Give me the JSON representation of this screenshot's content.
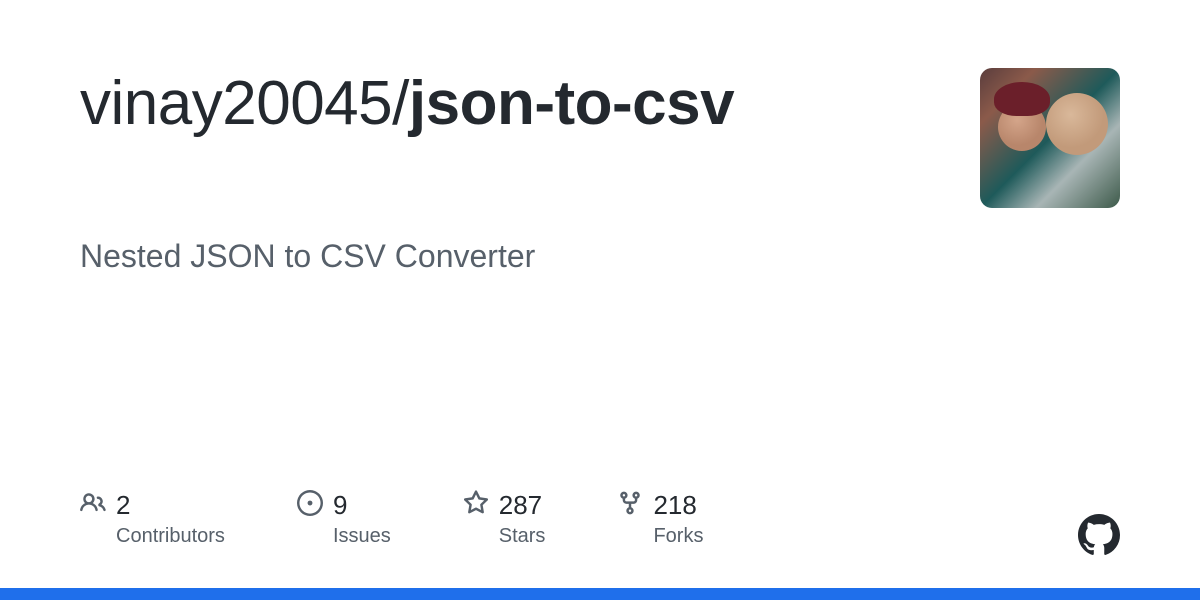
{
  "repo": {
    "owner": "vinay20045",
    "name": "json-to-csv",
    "description": "Nested JSON to CSV Converter"
  },
  "stats": {
    "contributors": {
      "count": "2",
      "label": "Contributors"
    },
    "issues": {
      "count": "9",
      "label": "Issues"
    },
    "stars": {
      "count": "287",
      "label": "Stars"
    },
    "forks": {
      "count": "218",
      "label": "Forks"
    }
  },
  "colors": {
    "accent": "#1f6feb"
  }
}
